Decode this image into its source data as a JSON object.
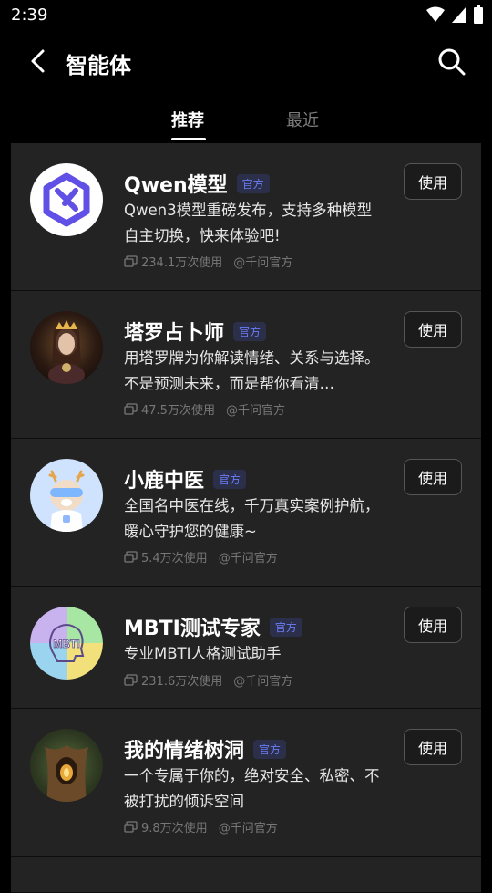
{
  "status": {
    "time": "2:39"
  },
  "header": {
    "title": "智能体"
  },
  "tabs": [
    {
      "label": "推荐"
    },
    {
      "label": "最近"
    }
  ],
  "agents": [
    {
      "name": "Qwen模型",
      "badge": "官方",
      "desc": "Qwen3模型重磅发布，支持多种模型自主切换，快来体验吧!",
      "usage": "234.1万次使用",
      "author": "@千问官方",
      "button": "使用"
    },
    {
      "name": "塔罗占卜师",
      "badge": "官方",
      "desc": "用塔罗牌为你解读情绪、关系与选择。不是预测未来，而是帮你看清…",
      "usage": "47.5万次使用",
      "author": "@千问官方",
      "button": "使用"
    },
    {
      "name": "小鹿中医",
      "badge": "官方",
      "desc": "全国名中医在线，千万真实案例护航，暖心守护您的健康~",
      "usage": "5.4万次使用",
      "author": "@千问官方",
      "button": "使用"
    },
    {
      "name": "MBTI测试专家",
      "badge": "官方",
      "desc": "专业MBTI人格测试助手",
      "usage": "231.6万次使用",
      "author": "@千问官方",
      "button": "使用",
      "avatar_text": "MBTI"
    },
    {
      "name": "我的情绪树洞",
      "badge": "官方",
      "desc": "一个专属于你的，绝对安全、私密、不被打扰的倾诉空间",
      "usage": "9.8万次使用",
      "author": "@千问官方",
      "button": "使用"
    }
  ]
}
